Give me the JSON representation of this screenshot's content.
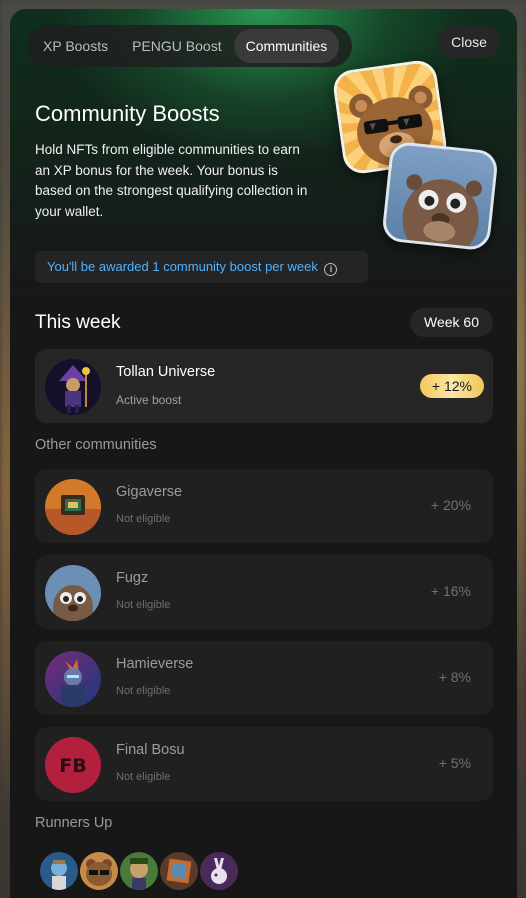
{
  "tabs": [
    {
      "label": "XP Boosts",
      "active": false
    },
    {
      "label": "PENGU Boost",
      "active": false
    },
    {
      "label": "Communities",
      "active": true
    }
  ],
  "close_label": "Close",
  "hero": {
    "title": "Community Boosts",
    "description": "Hold NFTs from eligible communities to earn an XP bonus for the week. Your bonus is based on the strongest qualifying collection in your wallet."
  },
  "info": {
    "text": "You'll be awarded 1 community boost per week",
    "icon": "info-icon"
  },
  "this_week": {
    "title": "This week",
    "week_badge": "Week 60",
    "active_community": {
      "name": "Tollan Universe",
      "status": "Active boost",
      "boost": "+ 12%"
    }
  },
  "other": {
    "title": "Other communities",
    "items": [
      {
        "name": "Gigaverse",
        "status": "Not eligible",
        "boost": "+ 20%"
      },
      {
        "name": "Fugz",
        "status": "Not eligible",
        "boost": "+ 16%"
      },
      {
        "name": "Hamieverse",
        "status": "Not eligible",
        "boost": "+ 8%"
      },
      {
        "name": "Final Bosu",
        "status": "Not eligible",
        "boost": "+ 5%",
        "logo_text": "FB"
      }
    ]
  },
  "runners_up": {
    "title": "Runners Up",
    "avatars": [
      "runner-avatar-1",
      "runner-avatar-2",
      "runner-avatar-3",
      "runner-avatar-4",
      "runner-avatar-5"
    ]
  },
  "colors": {
    "accent_blue": "#4fb3ff",
    "gold": "#f4c85a",
    "hero_green": "#2eaa5a",
    "panel": "#171717"
  }
}
